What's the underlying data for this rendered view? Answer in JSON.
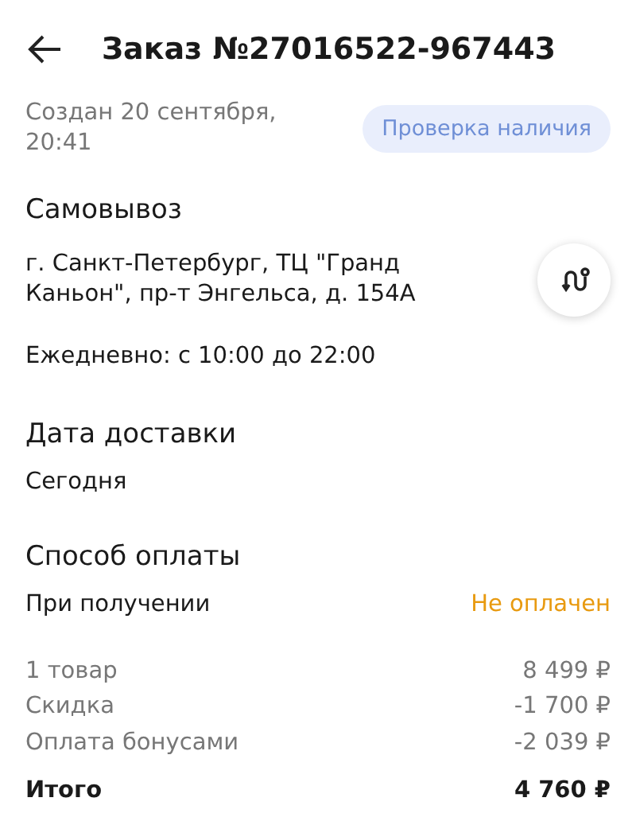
{
  "header": {
    "title": "Заказ №27016522-967443"
  },
  "created": {
    "text": "Создан 20 сентября, 20:41",
    "status": "Проверка наличия"
  },
  "pickup": {
    "heading": "Самовывоз",
    "address": "г. Санкт-Петербург, ТЦ \"Гранд Каньон\", пр-т Энгельса, д. 154А",
    "hours": "Ежедневно: с 10:00 до 22:00"
  },
  "delivery": {
    "heading": "Дата доставки",
    "value": "Сегодня"
  },
  "payment": {
    "heading": "Способ оплаты",
    "method": "При получении",
    "status": "Не оплачен",
    "paid": false
  },
  "summary": [
    {
      "kind": "line",
      "label": "1 товар",
      "value": "8 499 ₽"
    },
    {
      "kind": "line",
      "label": "Скидка",
      "value": "-1 700 ₽"
    },
    {
      "kind": "line",
      "label": "Оплата бонусами",
      "value": "-2 039 ₽"
    },
    {
      "kind": "total",
      "label": "Итого",
      "value": "4 760 ₽"
    }
  ]
}
